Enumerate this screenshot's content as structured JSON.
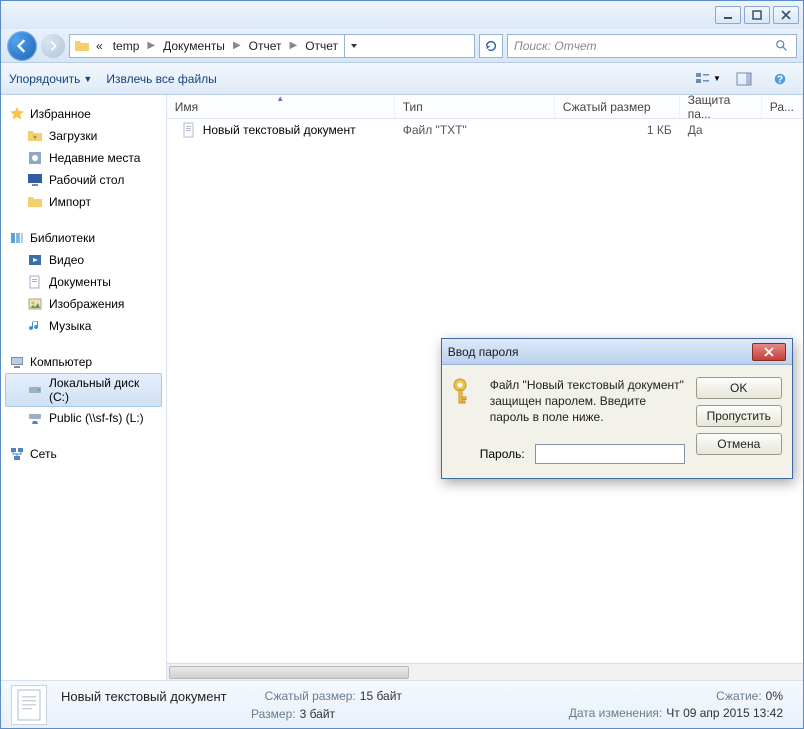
{
  "titlebar": {
    "minimize": "_",
    "maximize": "□",
    "close": "×"
  },
  "nav": {
    "crumbs": [
      "temp",
      "Документы",
      "Отчет",
      "Отчет"
    ],
    "prefix": "«",
    "search_placeholder": "Поиск: Отчет"
  },
  "toolbar": {
    "organize": "Упорядочить",
    "extract": "Извлечь все файлы"
  },
  "sidebar": {
    "favorites": {
      "label": "Избранное",
      "items": [
        "Загрузки",
        "Недавние места",
        "Рабочий стол",
        "Импорт"
      ]
    },
    "libraries": {
      "label": "Библиотеки",
      "items": [
        "Видео",
        "Документы",
        "Изображения",
        "Музыка"
      ]
    },
    "computer": {
      "label": "Компьютер",
      "items": [
        "Локальный диск (C:)",
        "Public (\\\\sf-fs) (L:)"
      ]
    },
    "network": {
      "label": "Сеть"
    }
  },
  "columns": {
    "name": "Имя",
    "type": "Тип",
    "csize": "Сжатый размер",
    "protected": "Защита па...",
    "rest": "Ра..."
  },
  "rows": [
    {
      "name": "Новый текстовый документ",
      "type": "Файл \"TXT\"",
      "csize": "1 КБ",
      "protected": "Да"
    }
  ],
  "status": {
    "filename": "Новый текстовый документ",
    "csize_k": "Сжатый размер:",
    "csize_v": "15 байт",
    "size_k": "Размер:",
    "size_v": "3 байт",
    "ratio_k": "Сжатие:",
    "ratio_v": "0%",
    "mdate_k": "Дата изменения:",
    "mdate_v": "Чт 09 апр 2015 13:42"
  },
  "dialog": {
    "title": "Ввод пароля",
    "message": "Файл \"Новый текстовый документ\" защищен паролем. Введите пароль в поле ниже.",
    "pwd_label": "Пароль:",
    "ok": "OK",
    "skip": "Пропустить",
    "cancel": "Отмена"
  }
}
